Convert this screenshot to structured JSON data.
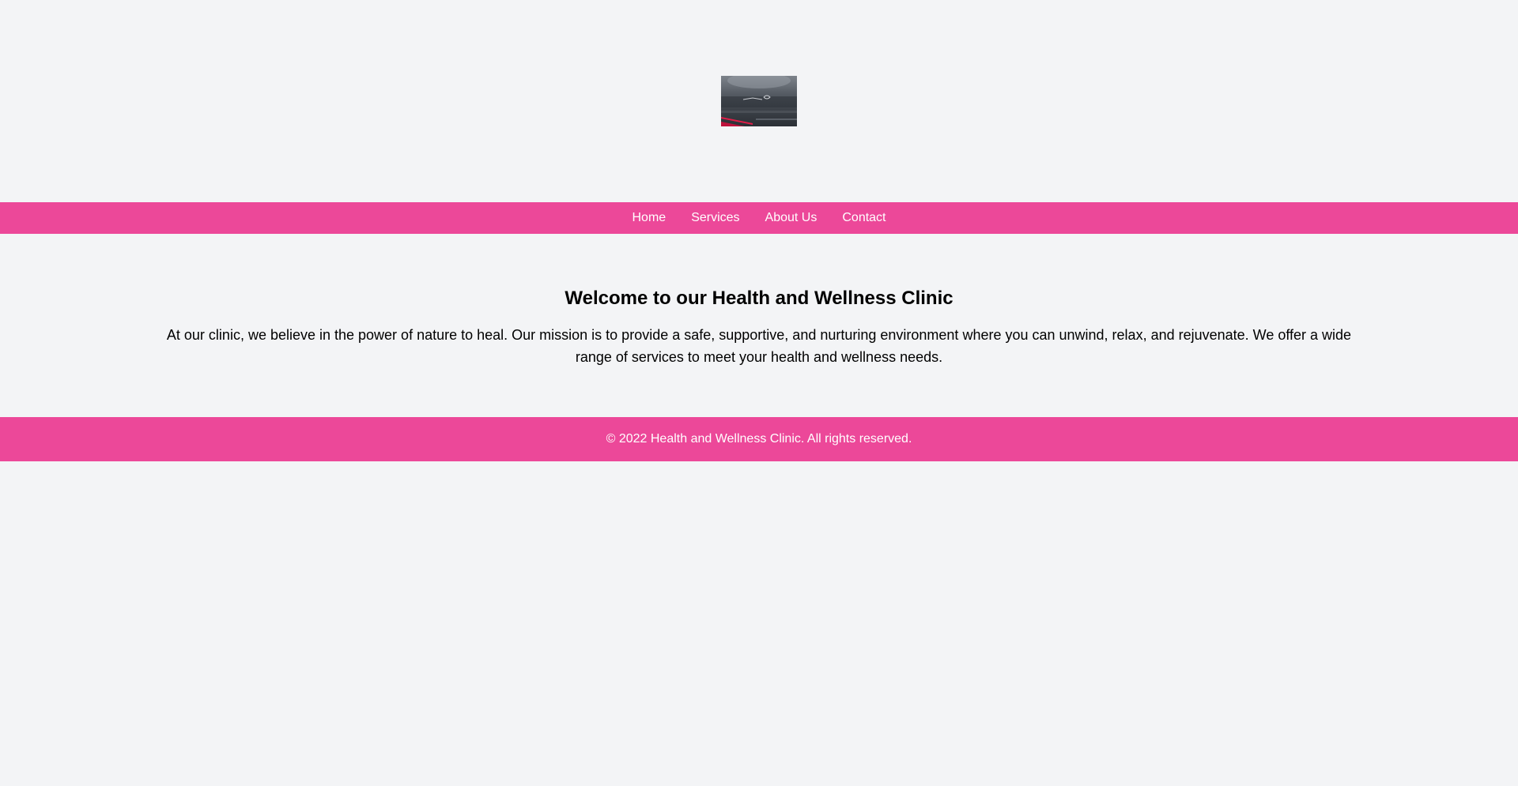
{
  "header": {
    "logo_alt": "Clinic logo"
  },
  "nav": {
    "items": [
      {
        "label": "Home"
      },
      {
        "label": "Services"
      },
      {
        "label": "About Us"
      },
      {
        "label": "Contact"
      }
    ]
  },
  "main": {
    "heading": "Welcome to our Health and Wellness Clinic",
    "body": "At our clinic, we believe in the power of nature to heal. Our mission is to provide a safe, supportive, and nurturing environment where you can unwind, relax, and rejuvenate. We offer a wide range of services to meet your health and wellness needs."
  },
  "footer": {
    "copyright": "© 2022 Health and Wellness Clinic. All rights reserved."
  },
  "colors": {
    "background": "#f3f4f6",
    "accent": "#ec4899",
    "text": "#000000",
    "nav_text": "#ffffff"
  }
}
